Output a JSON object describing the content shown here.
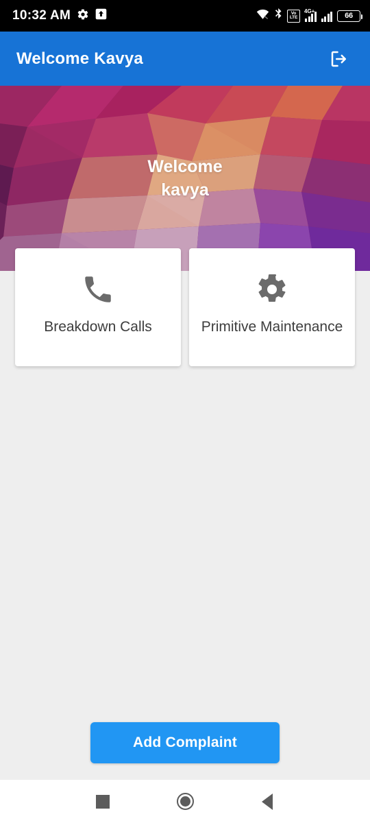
{
  "status_bar": {
    "time": "10:32 AM",
    "left_icons": [
      "gear-icon",
      "upload-box-icon"
    ],
    "right_icons": [
      "wifi-icon",
      "bluetooth-icon",
      "volte-icon",
      "signal-4gplus-icon",
      "signal-icon",
      "battery-icon"
    ],
    "volte_top": "Vo",
    "volte_bottom": "LTE",
    "network_label": "4G+",
    "battery_level": "66"
  },
  "app_bar": {
    "title": "Welcome Kavya",
    "logout_icon": "logout-icon",
    "background_color": "#1773d6"
  },
  "hero": {
    "line1": "Welcome",
    "line2": "kavya"
  },
  "cards": [
    {
      "icon": "phone-icon",
      "label": "Breakdown Calls"
    },
    {
      "icon": "gear-icon",
      "label": "Primitive Maintenance"
    }
  ],
  "cta": {
    "label": "Add Complaint",
    "color": "#2196f3"
  },
  "nav_bar": {
    "recents_label": "recents-square-icon",
    "home_label": "home-circle-icon",
    "back_label": "back-triangle-icon"
  },
  "colors": {
    "body_background": "#eeeeee",
    "card_background": "#ffffff",
    "icon_gray": "#6b6b6b",
    "text_gray": "#3d3d3d"
  }
}
